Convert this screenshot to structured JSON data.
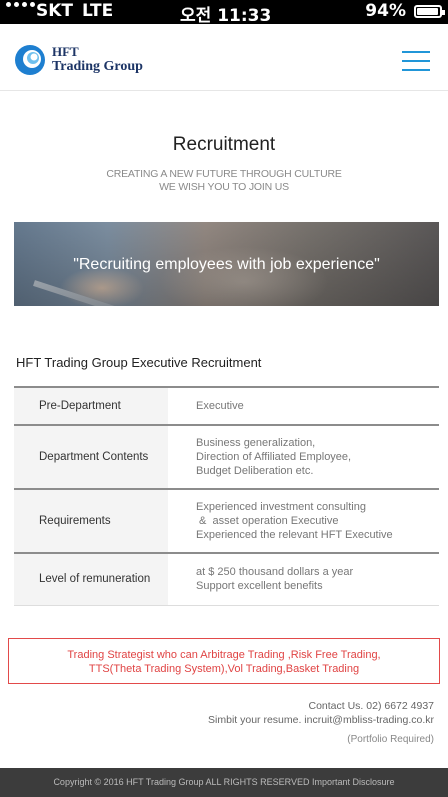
{
  "status_bar": {
    "carrier": "SKT",
    "network": "LTE",
    "time": "오전 11:33",
    "battery": "94%",
    "battery_level": 0.94
  },
  "header": {
    "logo_line1": "HFT",
    "logo_line2": "Trading Group",
    "menu_icon": "hamburger-icon",
    "accent": "#2196d8"
  },
  "page": {
    "title": "Recruitment",
    "subtitle_line1": "CREATING A NEW FUTURE THROUGH CULTURE",
    "subtitle_line2": "WE WISH YOU TO JOIN US"
  },
  "banner": {
    "text": "\"Recruiting employees with job experience\""
  },
  "section": {
    "title": "HFT Trading Group Executive  Recruitment"
  },
  "table": {
    "rows": [
      {
        "label": "Pre-Department",
        "lines": [
          "Executive"
        ]
      },
      {
        "label": "Department Contents",
        "lines": [
          "Business generalization,",
          "Direction of Affiliated Employee,",
          "Budget Deliberation etc."
        ]
      },
      {
        "label": "Requirements",
        "lines": [
          "Experienced investment consulting",
          " &  asset operation Executive",
          "Experienced the relevant HFT Executive"
        ]
      },
      {
        "label": "Level of remuneration",
        "lines": [
          "at $ 250 thousand dollars a year",
          "Support excellent benefits"
        ]
      }
    ]
  },
  "highlight": {
    "line1": "Trading Strategist who can Arbitrage Trading ,Risk Free Trading,",
    "line2": "TTS(Theta Trading System),Vol Trading,Basket Trading",
    "color": "#e04444"
  },
  "contact": {
    "line1": "Contact Us. 02) 6672 4937",
    "line2": "Simbit your resume. incruit@mbliss-trading.co.kr",
    "note": "(Portfolio Required)"
  },
  "footer": {
    "text": "Copyright © 2016  HFT Trading Group   ALL RIGHTS RESERVED   Important Disclosure"
  }
}
